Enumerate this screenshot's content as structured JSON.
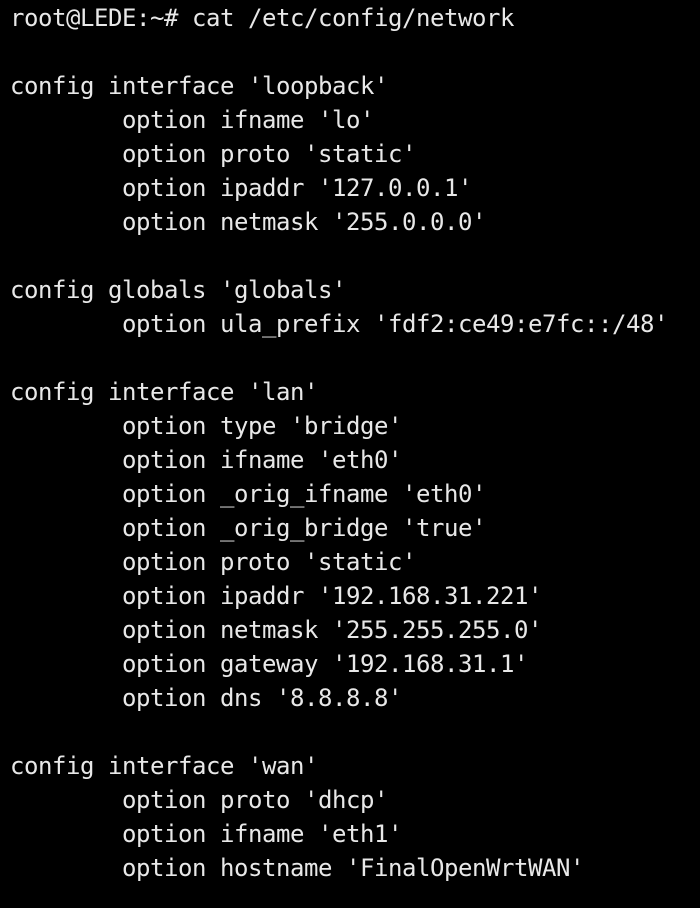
{
  "terminal": {
    "text_color": "#e8e8e8",
    "background_color": "#000000",
    "prompt": "root@LEDE:~# ",
    "command": "cat /etc/config/network",
    "lines": [
      {
        "indent": false,
        "text": "root@LEDE:~# cat /etc/config/network"
      },
      {
        "indent": false,
        "text": ""
      },
      {
        "indent": false,
        "text": "config interface 'loopback'"
      },
      {
        "indent": true,
        "text": "option ifname 'lo'"
      },
      {
        "indent": true,
        "text": "option proto 'static'"
      },
      {
        "indent": true,
        "text": "option ipaddr '127.0.0.1'"
      },
      {
        "indent": true,
        "text": "option netmask '255.0.0.0'"
      },
      {
        "indent": false,
        "text": ""
      },
      {
        "indent": false,
        "text": "config globals 'globals'"
      },
      {
        "indent": true,
        "text": "option ula_prefix 'fdf2:ce49:e7fc::/48'"
      },
      {
        "indent": false,
        "text": ""
      },
      {
        "indent": false,
        "text": "config interface 'lan'"
      },
      {
        "indent": true,
        "text": "option type 'bridge'"
      },
      {
        "indent": true,
        "text": "option ifname 'eth0'"
      },
      {
        "indent": true,
        "text": "option _orig_ifname 'eth0'"
      },
      {
        "indent": true,
        "text": "option _orig_bridge 'true'"
      },
      {
        "indent": true,
        "text": "option proto 'static'"
      },
      {
        "indent": true,
        "text": "option ipaddr '192.168.31.221'"
      },
      {
        "indent": true,
        "text": "option netmask '255.255.255.0'"
      },
      {
        "indent": true,
        "text": "option gateway '192.168.31.1'"
      },
      {
        "indent": true,
        "text": "option dns '8.8.8.8'"
      },
      {
        "indent": false,
        "text": ""
      },
      {
        "indent": false,
        "text": "config interface 'wan'"
      },
      {
        "indent": true,
        "text": "option proto 'dhcp'"
      },
      {
        "indent": true,
        "text": "option ifname 'eth1'"
      },
      {
        "indent": true,
        "text": "option hostname 'FinalOpenWrtWAN'"
      }
    ]
  }
}
